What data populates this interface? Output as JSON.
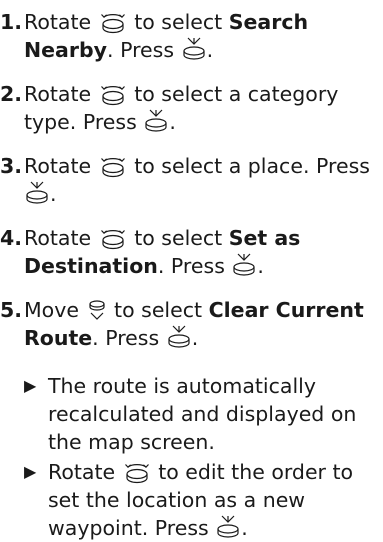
{
  "steps": [
    {
      "number": "1.",
      "a": "Rotate",
      "b": "to select",
      "target": "Search Nearby",
      "c": ". Press",
      "d": "."
    },
    {
      "number": "2.",
      "a": "Rotate",
      "b": "to select a category type. Press",
      "c": "."
    },
    {
      "number": "3.",
      "a": "Rotate",
      "b": "to select a place. Press",
      "c": "."
    },
    {
      "number": "4.",
      "a": "Rotate",
      "b": "to select",
      "target": "Set as Destination",
      "c": ". Press",
      "d": "."
    },
    {
      "number": "5.",
      "a": "Move",
      "b": "to select",
      "target": "Clear Current Route",
      "c": ". Press",
      "d": "."
    }
  ],
  "notes": [
    {
      "text": "The route is automatically recalculated and displayed on the map screen."
    },
    {
      "a": "Rotate",
      "b": "to edit the order to set the location as a new waypoint. Press",
      "c": "."
    }
  ],
  "icons": {
    "rotate": "rotate-knob-icon",
    "press": "press-knob-icon",
    "move": "move-knob-icon",
    "bullet": "triangle-bullet-icon"
  }
}
